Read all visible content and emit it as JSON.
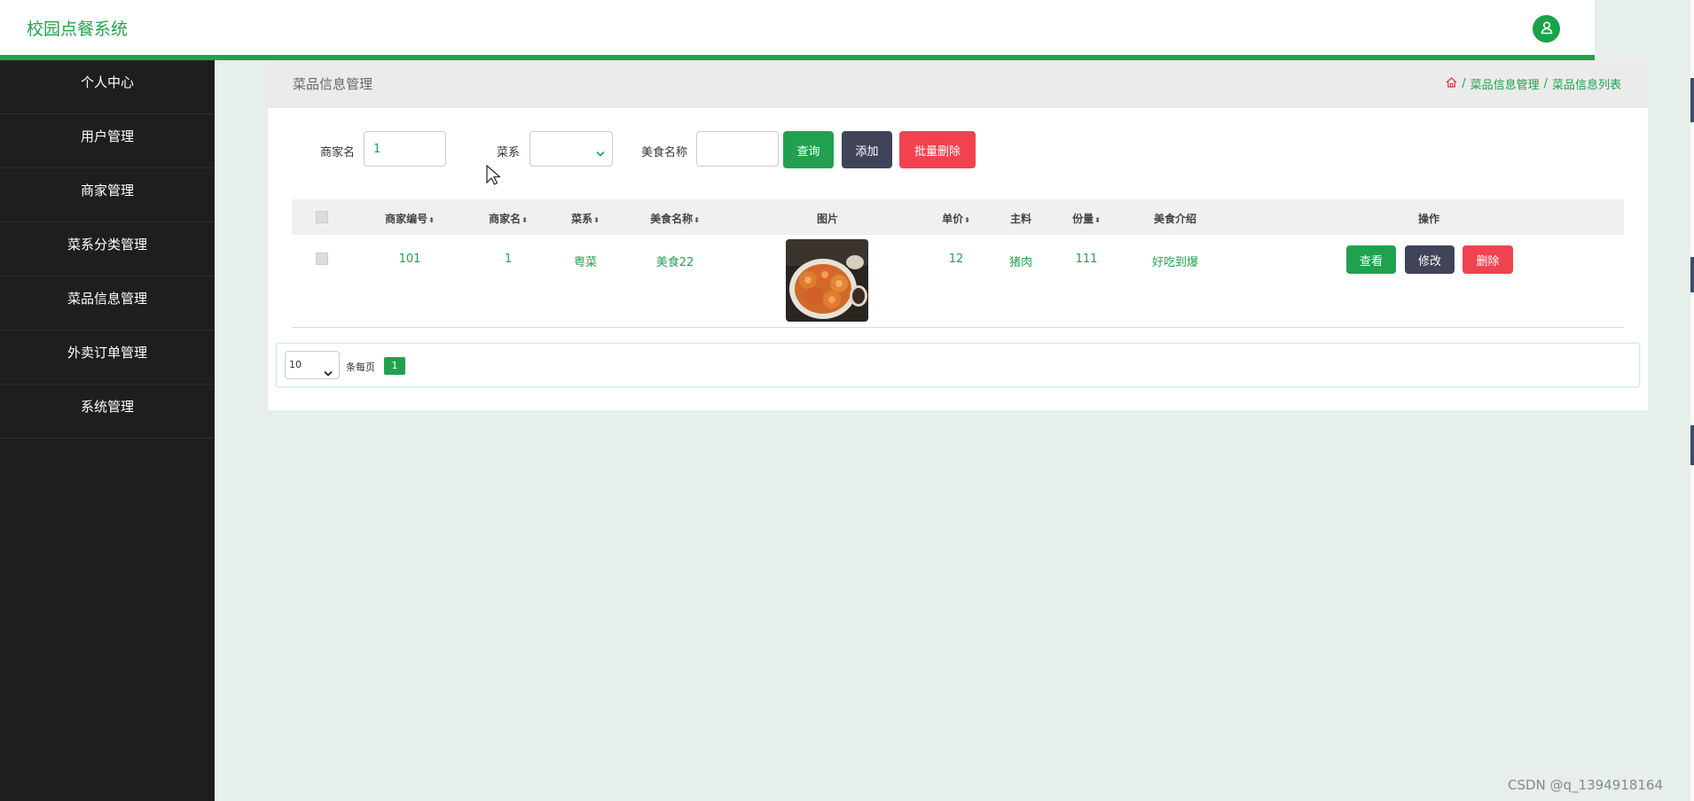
{
  "app": {
    "title": "校园点餐系统"
  },
  "sidebar": {
    "items": [
      {
        "label": "个人中心"
      },
      {
        "label": "用户管理"
      },
      {
        "label": "商家管理"
      },
      {
        "label": "菜系分类管理"
      },
      {
        "label": "菜品信息管理"
      },
      {
        "label": "外卖订单管理"
      },
      {
        "label": "系统管理"
      }
    ]
  },
  "panel": {
    "title": "菜品信息管理",
    "breadcrumb": [
      "菜品信息管理",
      "菜品信息列表"
    ],
    "breadcrumb_sep": "/"
  },
  "search": {
    "merchant_label": "商家名",
    "merchant_value": "1",
    "cuisine_label": "菜系",
    "cuisine_value": "",
    "food_label": "美食名称",
    "food_value": "",
    "query_btn": "查询",
    "add_btn": "添加",
    "batch_delete_btn": "批量删除"
  },
  "table": {
    "headers": {
      "merchant_no": "商家编号",
      "merchant_name": "商家名",
      "cuisine": "菜系",
      "food_name": "美食名称",
      "image": "图片",
      "price": "单价",
      "main_ingredient": "主料",
      "portion": "份量",
      "intro": "美食介绍",
      "actions": "操作"
    },
    "rows": [
      {
        "merchant_no": "101",
        "merchant_name": "1",
        "cuisine": "粤菜",
        "food_name": "美食22",
        "price": "12",
        "main_ingredient": "猪肉",
        "portion": "111",
        "intro": "好吃到爆",
        "view": "查看",
        "edit": "修改",
        "delete": "删除"
      }
    ]
  },
  "pagination": {
    "page_size": "10",
    "per_page_label": "条每页",
    "current_page": "1"
  },
  "watermark": "CSDN @q_1394918164",
  "colors": {
    "brand_green": "#21a150",
    "dark_button": "#3f4459",
    "danger": "#f0434f",
    "sidebar_bg": "#1e1e1e"
  },
  "icons": {
    "avatar": "user-icon",
    "home": "home-icon",
    "dropdown": "chevron-down-icon",
    "sort": "sort-icon"
  }
}
